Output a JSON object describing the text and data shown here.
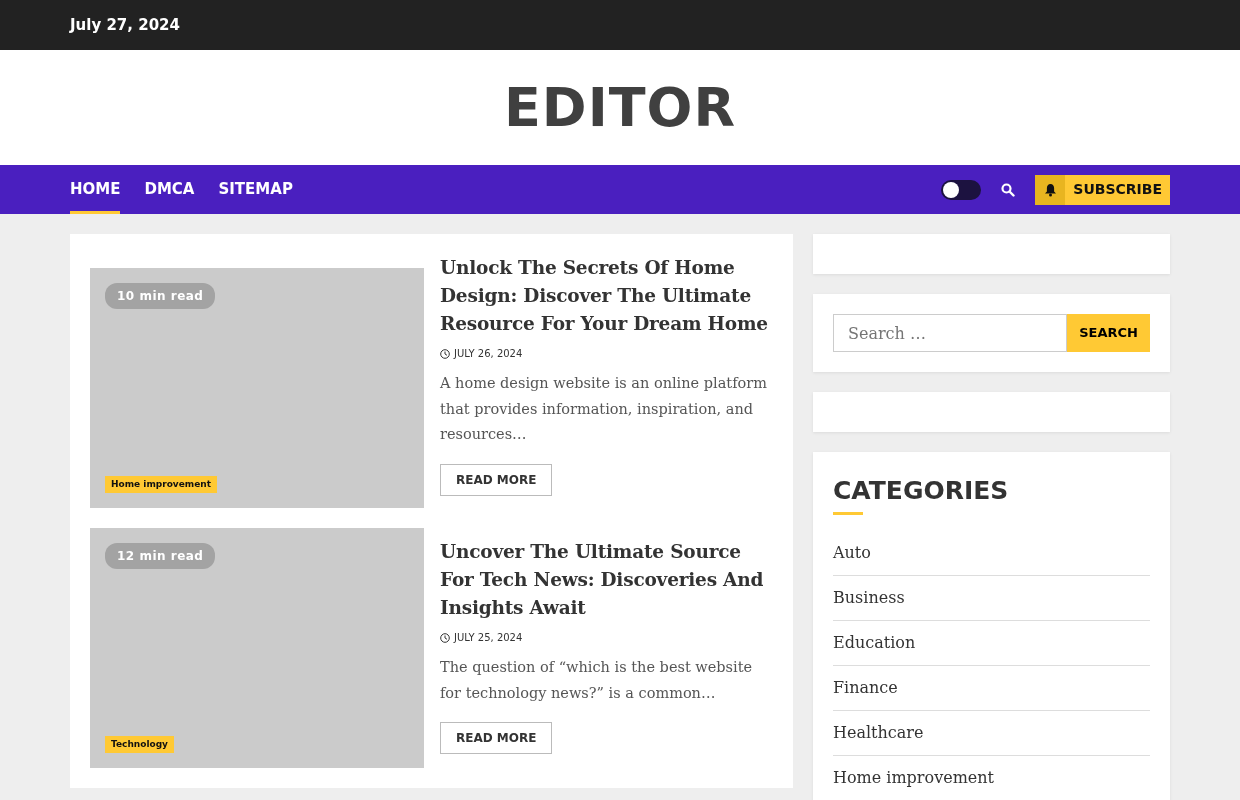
{
  "top_bar": {
    "date": "July 27, 2024"
  },
  "site_title": "EDITOR",
  "nav": {
    "items": [
      {
        "label": "HOME",
        "selected": true
      },
      {
        "label": "DMCA",
        "selected": false
      },
      {
        "label": "SITEMAP",
        "selected": false
      }
    ],
    "dark_mode": false,
    "subscribe": "SUBSCRIBE"
  },
  "posts": [
    {
      "read_time": "10 min read",
      "category": "Home improvement",
      "title": "Unlock The Secrets Of Home Design: Discover The Ultimate Resource For Your Dream Home",
      "date": "JULY 26, 2024",
      "excerpt": "A home design website is an online platform that provides information, inspiration, and resources…",
      "button": "READ MORE"
    },
    {
      "read_time": "12 min read",
      "category": "Technology",
      "title": "Uncover The Ultimate Source For Tech News: Discoveries And Insights Await",
      "date": "JULY 25, 2024",
      "excerpt": "The question of “which is the best website for technology news?” is a common…",
      "button": "READ MORE"
    }
  ],
  "sidebar": {
    "search": {
      "placeholder": "Search …",
      "button": "SEARCH"
    },
    "categories": {
      "title": "CATEGORIES",
      "items": [
        "Auto",
        "Business",
        "Education",
        "Finance",
        "Healthcare",
        "Home improvement"
      ]
    }
  }
}
